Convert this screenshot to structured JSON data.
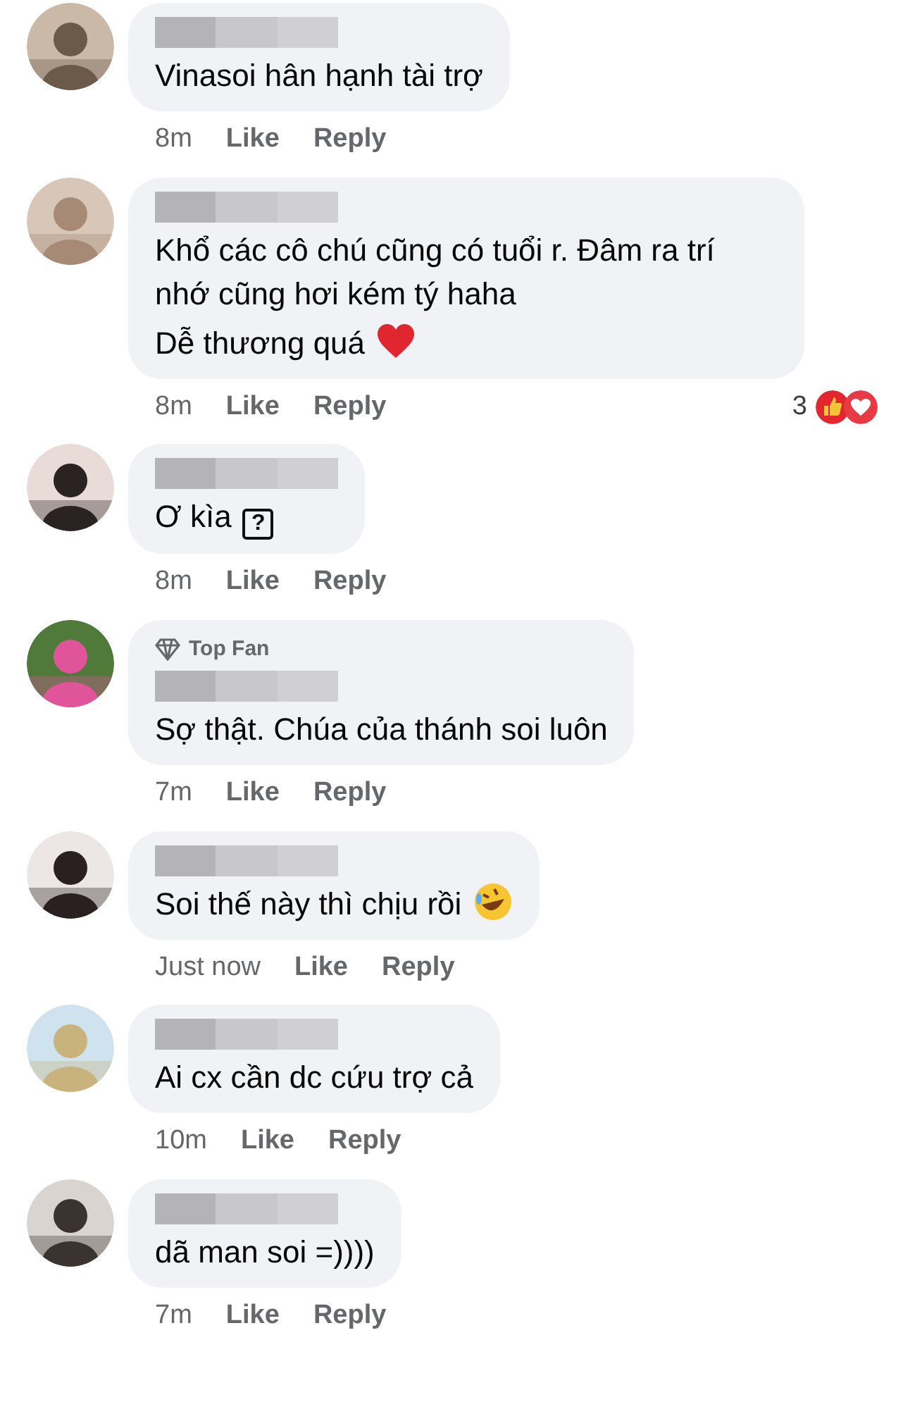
{
  "comments": [
    {
      "paragraphs": [
        {
          "text": "Vinasoi hân hạnh tài trợ"
        }
      ],
      "time": "8m",
      "like": "Like",
      "reply": "Reply"
    },
    {
      "paragraphs": [
        {
          "text": "Khổ các cô chú cũng có tuổi r. Đâm ra trí nhớ cũng hơi kém tý haha"
        },
        {
          "text": "Dễ thương quá",
          "emoji": {
            "kind": "heart"
          }
        }
      ],
      "time": "8m",
      "like": "Like",
      "reply": "Reply",
      "reactions": {
        "count": "3"
      }
    },
    {
      "paragraphs": [
        {
          "text": "Ơ kìa",
          "emoji": {
            "kind": "missing",
            "char": "?"
          }
        }
      ],
      "time": "8m",
      "like": "Like",
      "reply": "Reply"
    },
    {
      "badge": "Top Fan",
      "paragraphs": [
        {
          "text": "Sợ thật. Chúa của thánh soi luôn"
        }
      ],
      "time": "7m",
      "like": "Like",
      "reply": "Reply"
    },
    {
      "paragraphs": [
        {
          "text": "Soi thế này thì chịu rồi",
          "emoji": {
            "kind": "laugh"
          }
        }
      ],
      "time": "Just now",
      "like": "Like",
      "reply": "Reply"
    },
    {
      "paragraphs": [
        {
          "text": "Ai cx cần dc cứu trợ cả"
        }
      ],
      "time": "10m",
      "like": "Like",
      "reply": "Reply"
    },
    {
      "paragraphs": [
        {
          "text": "dã man soi =))))"
        }
      ],
      "time": "7m",
      "like": "Like",
      "reply": "Reply"
    }
  ]
}
